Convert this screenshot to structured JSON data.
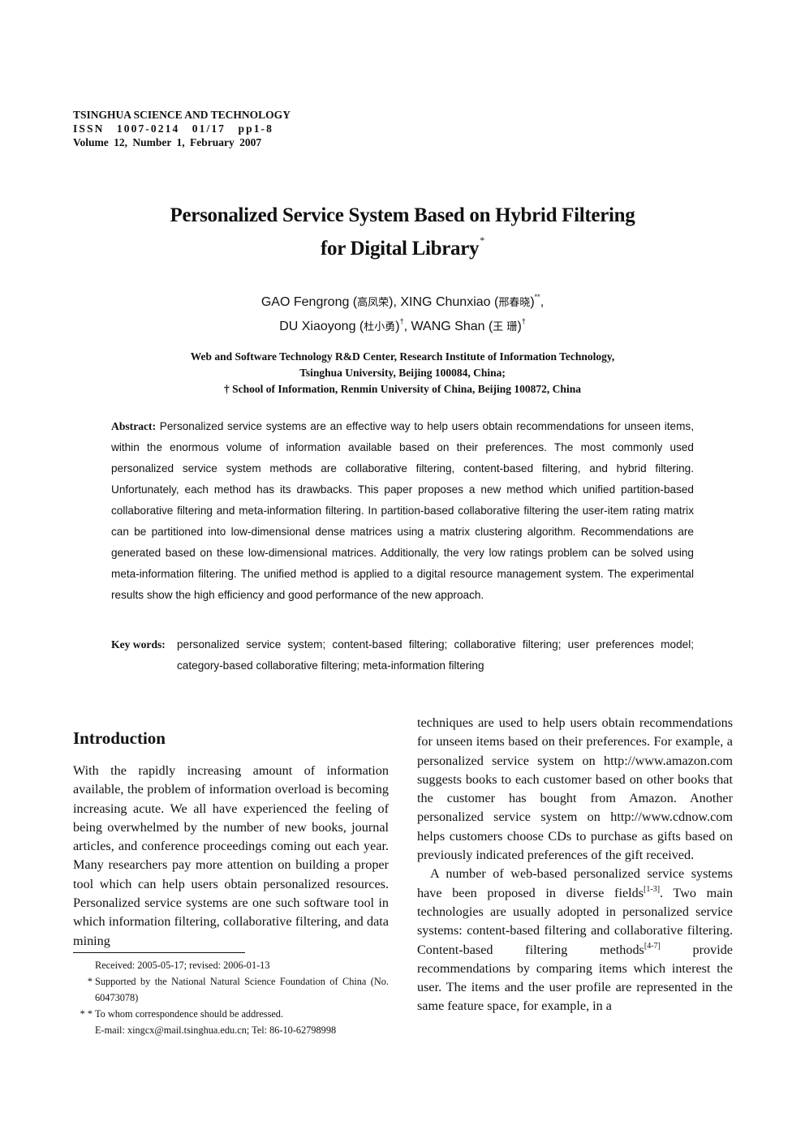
{
  "journal": {
    "name": "TSINGHUA SCIENCE AND TECHNOLOGY",
    "issn_line": "ISSN 1007-0214 01/17 pp1-8",
    "volume_line": "Volume 12, Number 1, February 2007"
  },
  "title": {
    "line1": "Personalized Service System Based on Hybrid Filtering",
    "line2": "for Digital Library",
    "mark": "*"
  },
  "authors": [
    {
      "name": "GAO Fengrong",
      "cn": "高凤荣",
      "mark": "",
      "sep": ", "
    },
    {
      "name": "XING Chunxiao",
      "cn": "邢春晓",
      "mark": "**",
      "sep": ","
    },
    {
      "name": "DU Xiaoyong",
      "cn": "杜小勇",
      "mark": "†",
      "sep": ", "
    },
    {
      "name": "WANG Shan",
      "cn": "王 珊",
      "mark": "†",
      "sep": ""
    }
  ],
  "affiliations": [
    "Web and Software Technology R&D Center, Research Institute of Information Technology,",
    "Tsinghua University, Beijing 100084, China;",
    "† School of Information, Renmin University of China, Beijing 100872, China"
  ],
  "abstract": {
    "label": "Abstract:",
    "text": "Personalized service systems are an effective way to help users obtain recommendations for unseen items, within the enormous volume of information available based on their preferences. The most commonly used personalized service system methods are collaborative filtering, content-based filtering, and hybrid filtering. Unfortunately, each method has its drawbacks. This paper proposes a new method which unified partition-based collaborative filtering and meta-information filtering. In partition-based collaborative filtering the user-item rating matrix can be partitioned into low-dimensional dense matrices using a matrix clustering algorithm. Recommendations are generated based on these low-dimensional matrices. Additionally, the very low ratings problem can be solved using meta-information filtering. The unified method is applied to a digital resource management system. The experimental results show the high efficiency and good performance of the new approach."
  },
  "keywords": {
    "label": "Key words:",
    "text": "personalized service system; content-based filtering; collaborative filtering; user preferences model; category-based collaborative filtering; meta-information filtering"
  },
  "introduction": {
    "heading": "Introduction",
    "left_paragraph": "With the rapidly increasing amount of information available, the problem of information overload is becoming increasing acute. We all have experienced the feeling of being overwhelmed by the number of new books, journal articles, and conference proceedings coming out each year. Many researchers pay more attention on building a proper tool which can help users obtain personalized resources. Personalized service systems are one such software tool in which information filtering, collaborative filtering, and data mining",
    "right_paragraph1": "techniques are used to help users obtain recommendations for unseen items based on their preferences. For example, a personalized service system on http://www.amazon.com suggests books to each customer based on other books that the customer has bought from Amazon. Another personalized service system on http://www.cdnow.com helps customers choose CDs to purchase as gifts based on previously indicated preferences of the gift received.",
    "right_paragraph2": {
      "part1": "A number of web-based personalized service systems have been proposed in diverse fields",
      "cite1": "[1-3]",
      "part2": ". Two main technologies are usually adopted in personalized service systems: content-based filtering and collaborative filtering. Content-based filtering methods",
      "cite2": "[4-7]",
      "part3": " provide recommendations by comparing items which interest the user. The items and the user profile are represented in the same feature space, for example, in a"
    }
  },
  "footnotes": [
    {
      "mark": "",
      "text": "Received: 2005-05-17; revised: 2006-01-13"
    },
    {
      "mark": "*",
      "text": "Supported by the National Natural Science Foundation of China (No. 60473078)"
    },
    {
      "mark": "* *",
      "text": "To whom correspondence should be addressed."
    },
    {
      "mark": "",
      "text": "E-mail: xingcx@mail.tsinghua.edu.cn; Tel: 86-10-62798998"
    }
  ]
}
